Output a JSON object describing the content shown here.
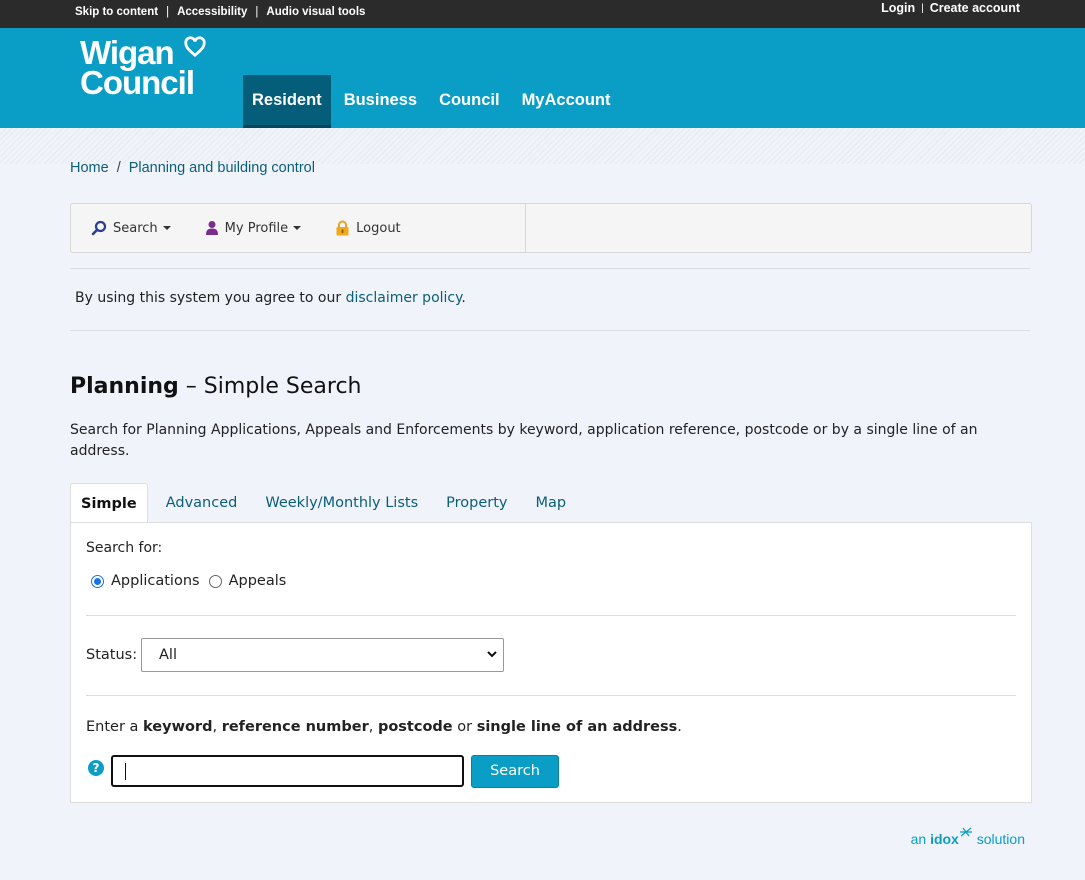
{
  "utility": {
    "skip": "Skip to content",
    "accessibility": "Accessibility",
    "audio": "Audio visual tools",
    "sep": "|",
    "login": "Login",
    "create": "Create account"
  },
  "logo": {
    "line1": "Wigan",
    "line2": "Council"
  },
  "nav": [
    "Resident",
    "Business",
    "Council",
    "MyAccount"
  ],
  "breadcrumb": {
    "home": "Home",
    "sep": "/",
    "current": "Planning and building control"
  },
  "toolbar": {
    "search": "Search",
    "profile": "My Profile",
    "logout": "Logout"
  },
  "disclaimer": {
    "prefix": "By using this system you agree to our ",
    "link": "disclaimer policy",
    "suffix": "."
  },
  "title": {
    "bold": "Planning",
    "rest": " – Simple Search"
  },
  "intro": "Search for Planning Applications, Appeals and Enforcements by keyword, application reference, postcode or by a single line of an address.",
  "tabs": [
    "Simple",
    "Advanced",
    "Weekly/Monthly Lists",
    "Property",
    "Map"
  ],
  "panel": {
    "search_for": "Search for:",
    "radio_applications": "Applications",
    "radio_appeals": "Appeals",
    "status_label": "Status:",
    "status_value": "All",
    "enter": {
      "p1": "Enter a ",
      "b1": "keyword",
      "p2": ", ",
      "b2": "reference number",
      "p3": ", ",
      "b3": "postcode",
      "p4": " or ",
      "b4": "single line of an address",
      "p5": "."
    },
    "help": "?",
    "search_button": "Search",
    "search_value": ""
  },
  "footer": {
    "an": "an ",
    "idox": "idox",
    "solution": " solution"
  },
  "colors": {
    "brand": "#0a9ec7",
    "nav_active": "#045e7a",
    "link": "#0b5e79"
  }
}
